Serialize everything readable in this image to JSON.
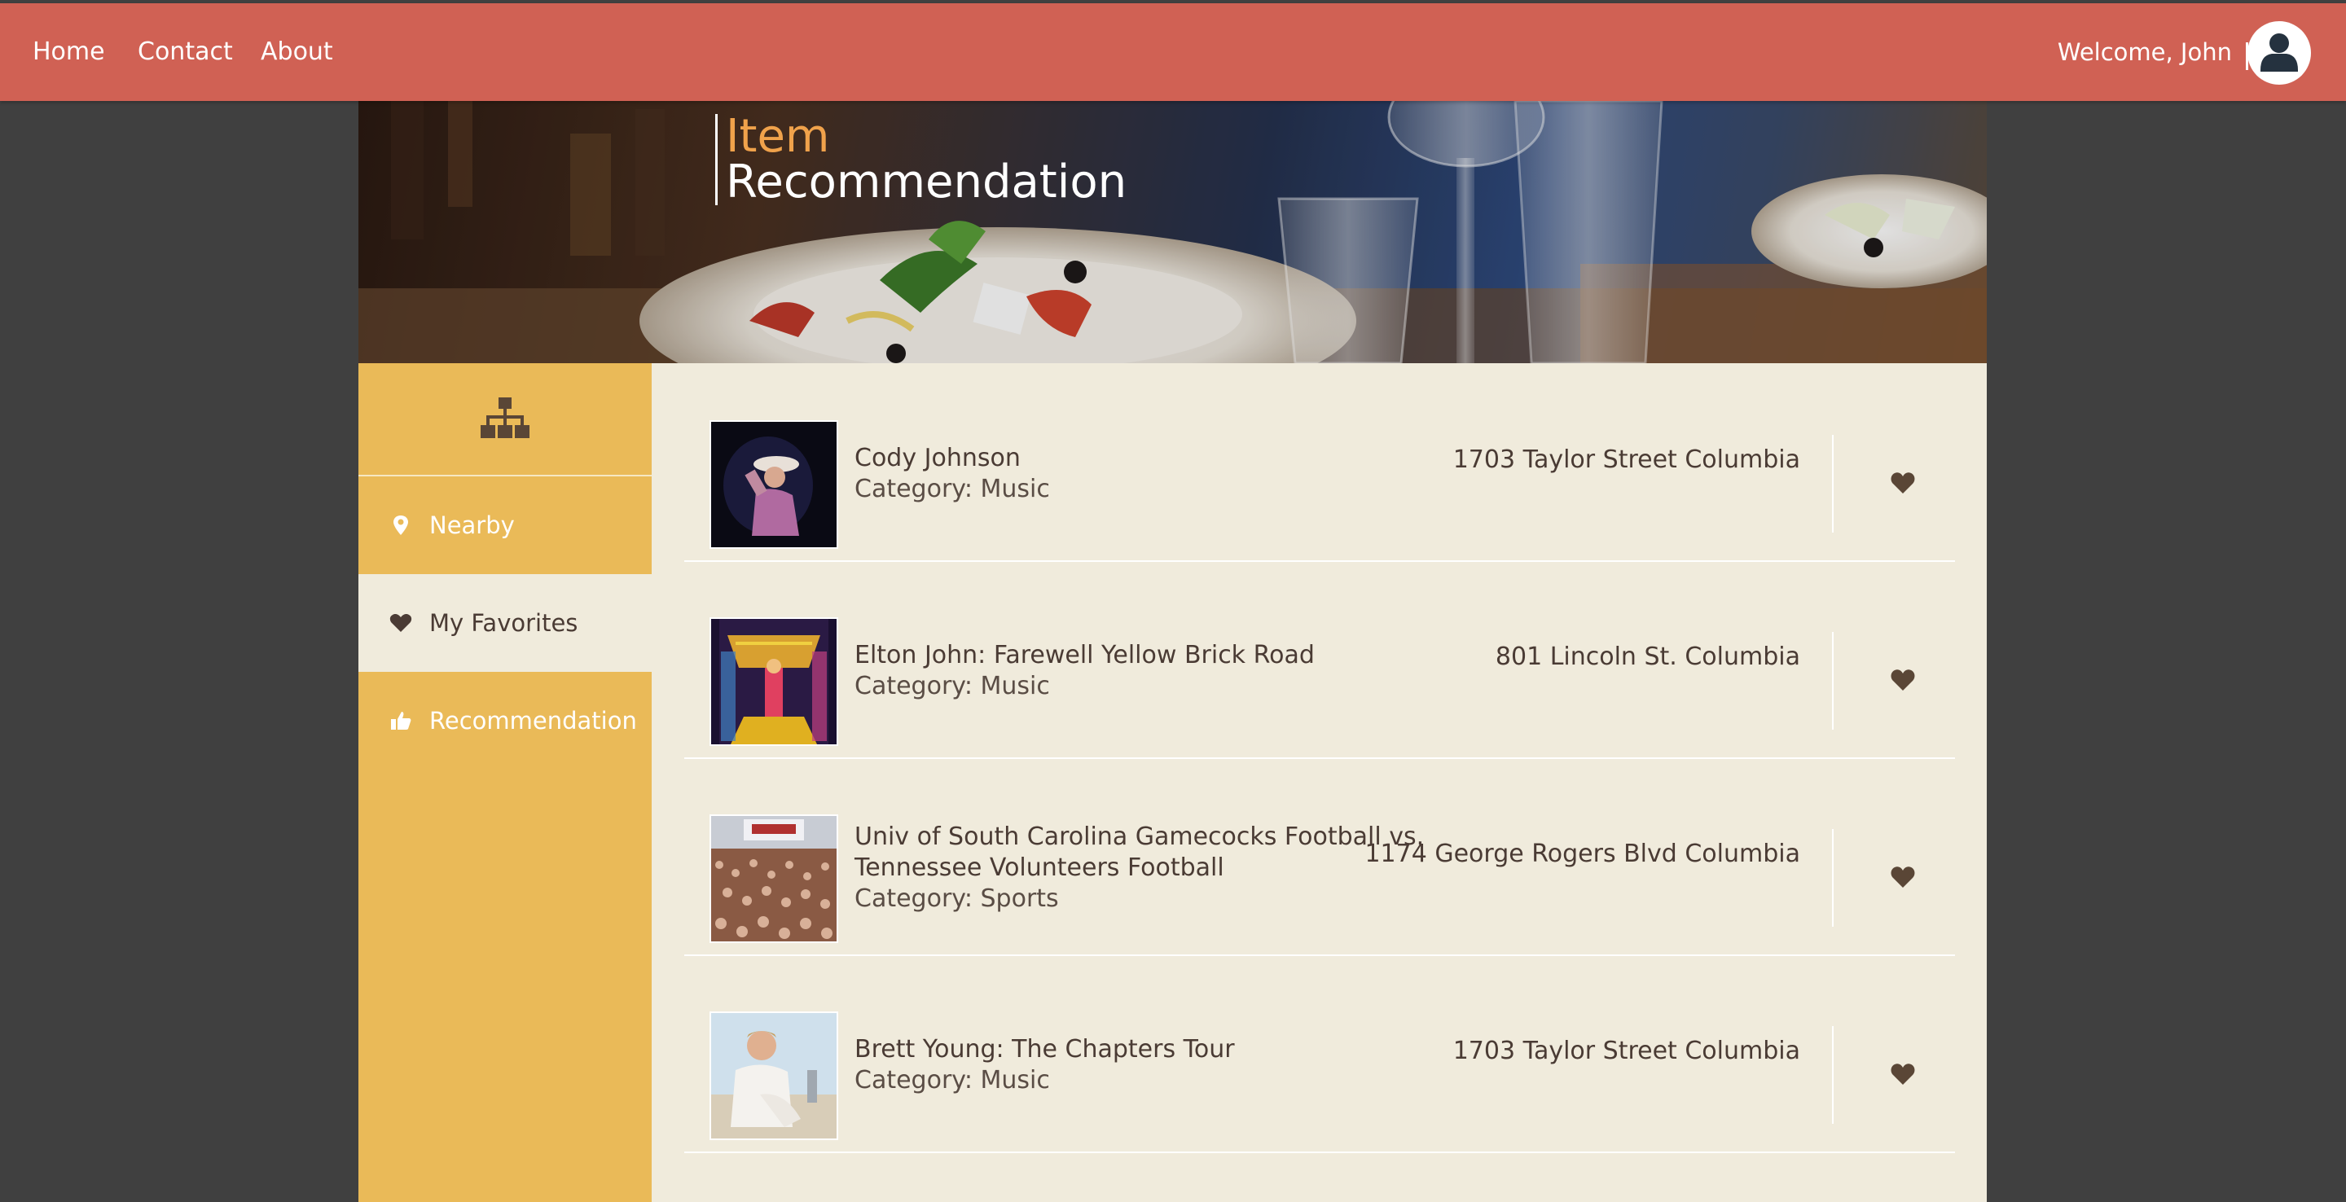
{
  "nav": {
    "home": "Home",
    "contact": "Contact",
    "about": "About",
    "welcome": "Welcome, John"
  },
  "banner": {
    "line1": "Item",
    "line2": "Recommendation"
  },
  "sidebar": {
    "items": [
      {
        "label": "Nearby",
        "icon": "map-marker-icon"
      },
      {
        "label": "My Favorites",
        "icon": "heart-icon",
        "active": true
      },
      {
        "label": "Recommendation",
        "icon": "thumbs-up-icon"
      }
    ]
  },
  "items": [
    {
      "name": "Cody Johnson",
      "category": "Category: Music",
      "address": "1703 Taylor Street Columbia"
    },
    {
      "name": "Elton John: Farewell Yellow Brick Road",
      "category": "Category: Music",
      "address": "801 Lincoln St. Columbia"
    },
    {
      "name": "Univ of South Carolina Gamecocks Football vs. Tennessee Volunteers Football",
      "category": "Category: Sports",
      "address": "1174 George Rogers Blvd Columbia"
    },
    {
      "name": "Brett Young: The Chapters Tour",
      "category": "Category: Music",
      "address": "1703 Taylor Street Columbia"
    }
  ],
  "colors": {
    "topbar": "#d06154",
    "sidebar": "#eaba58",
    "content": "#f0ebdc",
    "accent": "#f0a24b",
    "text": "#4a3b34",
    "background": "#404040"
  }
}
